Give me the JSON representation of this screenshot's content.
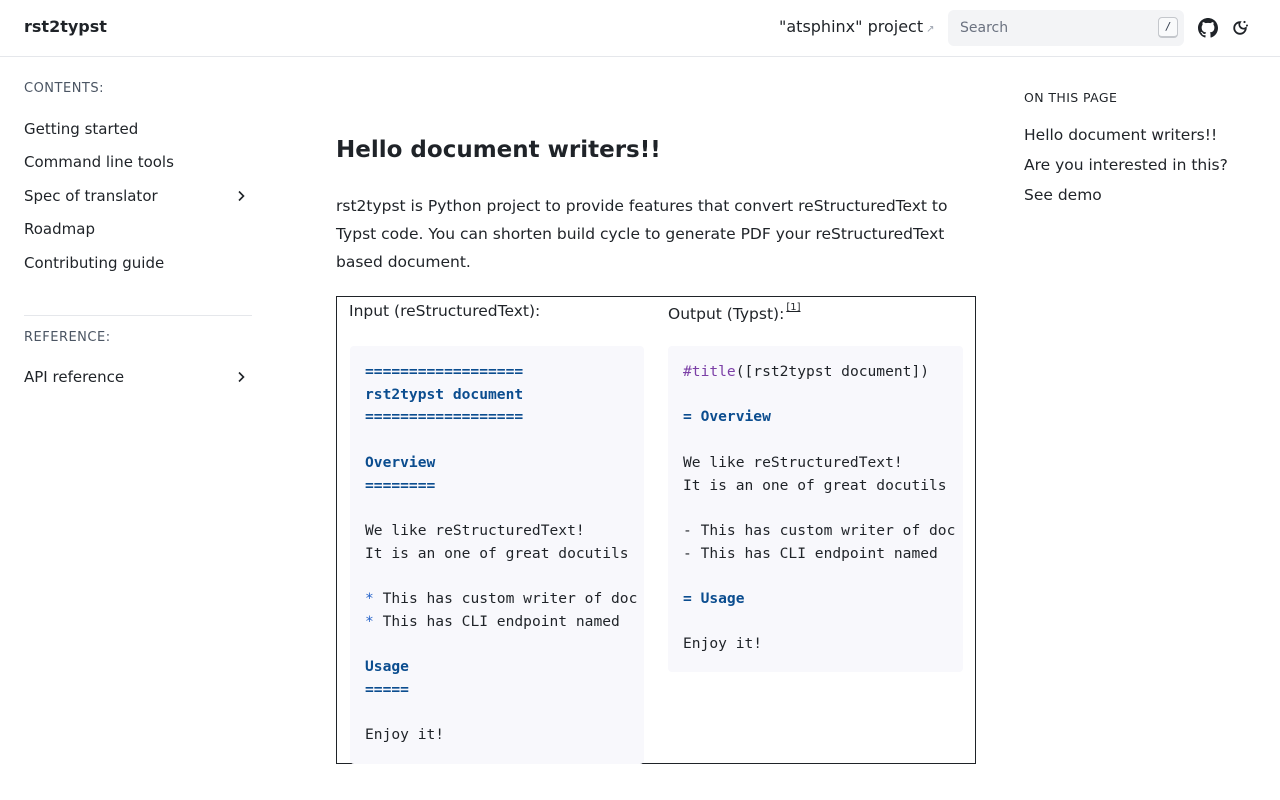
{
  "header": {
    "brand": "rst2typst",
    "project_link": "\"atsphinx\" project",
    "project_link_arrow": "↗",
    "search_placeholder": "Search",
    "search_shortcut": "/"
  },
  "sidebar": {
    "contents_caption": "CONTENTS:",
    "contents_items": [
      {
        "label": "Getting started",
        "expandable": false
      },
      {
        "label": "Command line tools",
        "expandable": false
      },
      {
        "label": "Spec of translator",
        "expandable": true
      },
      {
        "label": "Roadmap",
        "expandable": false
      },
      {
        "label": "Contributing guide",
        "expandable": false
      }
    ],
    "reference_caption": "REFERENCE:",
    "reference_items": [
      {
        "label": "API reference",
        "expandable": true
      }
    ]
  },
  "main": {
    "heading": "Hello document writers!!",
    "intro": "rst2typst is Python project to provide features that convert reStructuredText to Typst code. You can shorten build cycle to generate PDF your reStructuredText based document.",
    "input_label": "Input (reStructuredText):",
    "output_label": "Output (Typst):",
    "output_footnote": "[1]",
    "input_code": [
      {
        "text": "==================",
        "kind": "heading"
      },
      {
        "text": "rst2typst document",
        "kind": "heading"
      },
      {
        "text": "==================",
        "kind": "heading"
      },
      {
        "text": "",
        "kind": "plain"
      },
      {
        "text": "Overview",
        "kind": "heading"
      },
      {
        "text": "========",
        "kind": "heading"
      },
      {
        "text": "",
        "kind": "plain"
      },
      {
        "text": "We like reStructuredText!",
        "kind": "plain"
      },
      {
        "text": "It is an one of great docutils",
        "kind": "plain"
      },
      {
        "text": "",
        "kind": "plain"
      },
      {
        "bullet": "*",
        "text": " This has custom writer of doc",
        "kind": "bullet"
      },
      {
        "bullet": "*",
        "text": " This has CLI endpoint named",
        "kind": "bullet"
      },
      {
        "text": "",
        "kind": "plain"
      },
      {
        "text": "Usage",
        "kind": "heading"
      },
      {
        "text": "=====",
        "kind": "heading"
      },
      {
        "text": "",
        "kind": "plain"
      },
      {
        "text": "Enjoy it!",
        "kind": "plain"
      }
    ],
    "output_code": [
      {
        "func": "#title",
        "text": "([rst2typst document])",
        "kind": "func"
      },
      {
        "text": "",
        "kind": "plain"
      },
      {
        "text": "= Overview",
        "kind": "heading"
      },
      {
        "text": "",
        "kind": "plain"
      },
      {
        "text": "We like reStructuredText!",
        "kind": "plain"
      },
      {
        "text": "It is an one of great docutils",
        "kind": "plain"
      },
      {
        "text": "",
        "kind": "plain"
      },
      {
        "text": "- This has custom writer of doc",
        "kind": "plain"
      },
      {
        "text": "- This has CLI endpoint named",
        "kind": "plain"
      },
      {
        "text": "",
        "kind": "plain"
      },
      {
        "text": "= Usage",
        "kind": "heading"
      },
      {
        "text": "",
        "kind": "plain"
      },
      {
        "text": "Enjoy it!",
        "kind": "plain"
      }
    ]
  },
  "toc": {
    "caption": "ON THIS PAGE",
    "items": [
      "Hello document writers!!",
      "Are you interested in this?",
      "See demo"
    ]
  },
  "colors": {
    "heading_token": "#0b4d8f",
    "bullet_token": "#2563c9",
    "func_token": "#7b3fa6",
    "code_background": "#f8f8fc"
  },
  "icons": [
    "github-icon",
    "theme-toggle-icon",
    "chevron-right-icon",
    "external-link-icon"
  ]
}
